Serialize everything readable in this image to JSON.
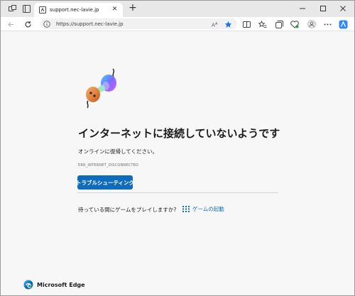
{
  "tab": {
    "title": "support.nec-lavie.jp"
  },
  "address": {
    "url": "https://support.nec-lavie.jp"
  },
  "icons": {
    "workspaces": "workspaces-icon",
    "tab_actions": "tab-actions-icon",
    "favicon": "page-favicon-icon",
    "back": "back-icon",
    "refresh": "refresh-icon",
    "info": "info-icon",
    "read_aloud": "read-aloud-icon",
    "favorite": "favorite-star-icon",
    "split": "split-screen-icon",
    "favorites": "favorites-icon",
    "collections": "collections-icon",
    "browser_essentials": "browser-essentials-icon",
    "profile": "profile-icon",
    "more": "more-icon",
    "copilot": "copilot-icon"
  },
  "colors": {
    "accent": "#0f6cbd",
    "background": "#f7f7f7"
  },
  "error": {
    "headline": "インターネットに接続していないようです",
    "subtext": "オンラインに復帰してください。",
    "code": "ERR_INTERNET_DISCONNECTED",
    "button": "トラブルシューティング",
    "game_prompt": "待っている間にゲームをプレイしますか?",
    "game_link": "ゲームの起動"
  },
  "brand": {
    "name": "Microsoft Edge"
  }
}
